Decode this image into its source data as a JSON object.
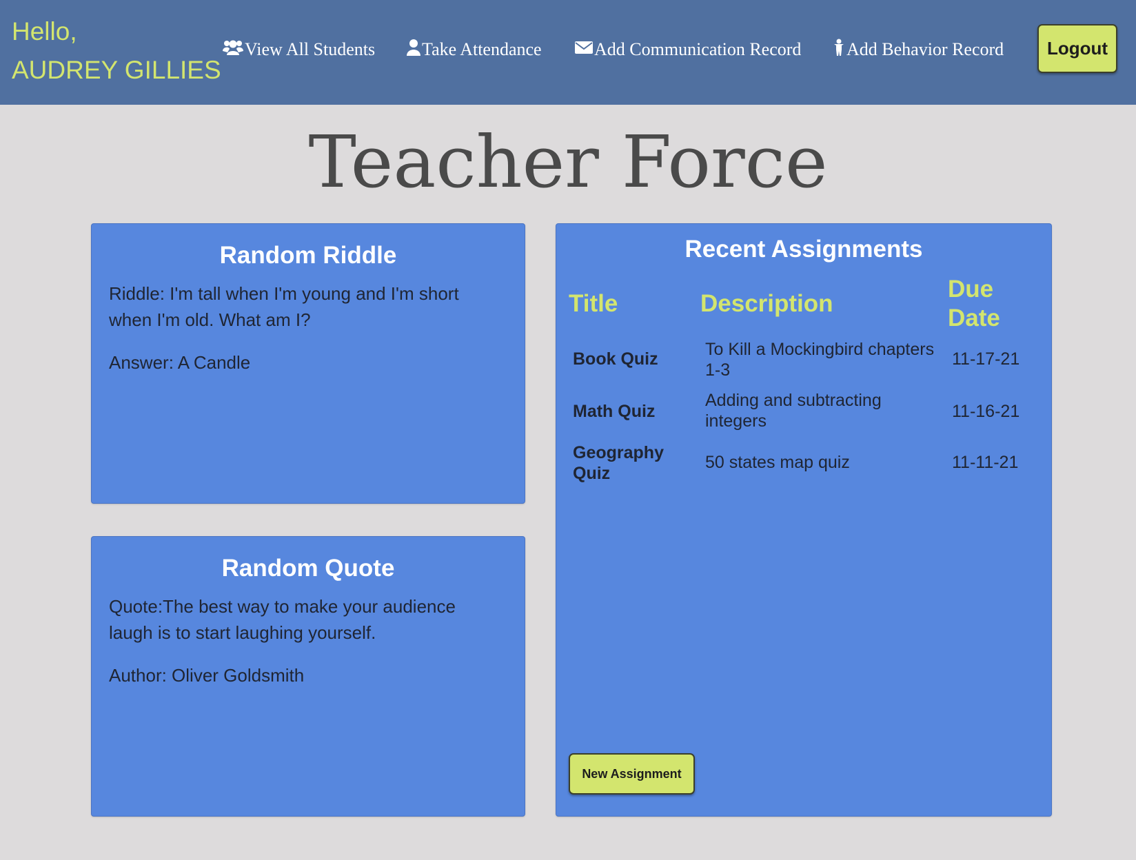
{
  "header": {
    "greeting": "Hello,",
    "user_name": "AUDREY GILLIES",
    "nav": [
      {
        "label": "View All Students",
        "icon": "users-icon"
      },
      {
        "label": "Take Attendance",
        "icon": "user-icon"
      },
      {
        "label": "Add Communication Record",
        "icon": "envelope-icon"
      },
      {
        "label": "Add Behavior Record",
        "icon": "child-icon"
      }
    ],
    "logout_label": "Logout"
  },
  "page_title": "Teacher Force",
  "riddle": {
    "title": "Random Riddle",
    "text": "Riddle: I'm tall when I'm young and I'm short when I'm old. What am I?",
    "answer": "Answer: A Candle"
  },
  "quote": {
    "title": "Random Quote",
    "text": "Quote:The best way to make your audience laugh is to start laughing yourself.",
    "author": "Author: Oliver Goldsmith"
  },
  "assignments": {
    "title": "Recent Assignments",
    "columns": [
      "Title",
      "Description",
      "Due Date"
    ],
    "rows": [
      {
        "title": "Book Quiz",
        "description": "To Kill a Mockingbird chapters 1-3",
        "due": "11-17-21"
      },
      {
        "title": "Math Quiz",
        "description": "Adding and subtracting integers",
        "due": "11-16-21"
      },
      {
        "title": "Geography Quiz",
        "description": "50 states map quiz",
        "due": "11-11-21"
      }
    ],
    "new_button_label": "New Assignment"
  },
  "colors": {
    "header_bg": "#5070a0",
    "accent": "#d3e56e",
    "card_bg": "#5787de",
    "page_bg": "#dddbdc",
    "title_text": "#4a4a4a"
  }
}
